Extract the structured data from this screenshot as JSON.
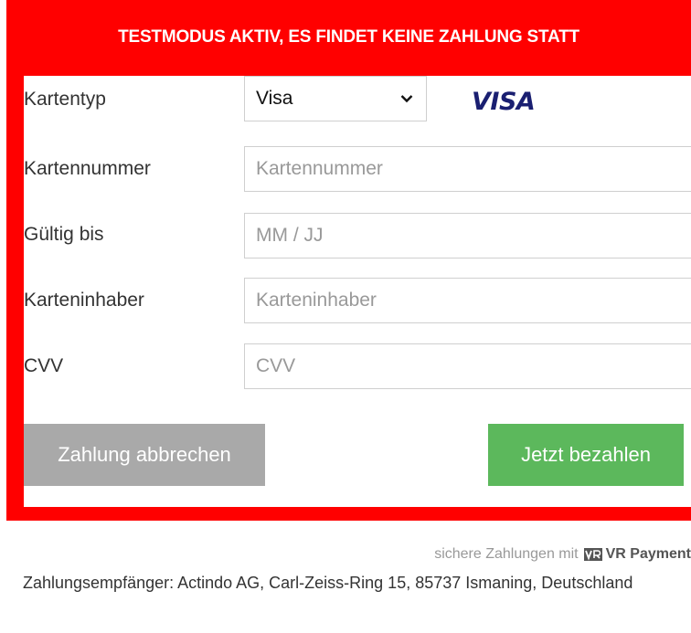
{
  "banner": {
    "text": "TESTMODUS AKTIV, ES FINDET KEINE ZAHLUNG STATT"
  },
  "form": {
    "card_type": {
      "label": "Kartentyp",
      "selected": "Visa",
      "logo_text": "VISA"
    },
    "card_number": {
      "label": "Kartennummer",
      "placeholder": "Kartennummer"
    },
    "expiry": {
      "label": "Gültig bis",
      "placeholder": "MM / JJ"
    },
    "holder": {
      "label": "Karteninhaber",
      "placeholder": "Karteninhaber"
    },
    "cvv": {
      "label": "CVV",
      "placeholder": "CVV"
    }
  },
  "buttons": {
    "cancel_label": "Zahlung abbrechen",
    "pay_label": "Jetzt bezahlen"
  },
  "footer": {
    "secure_text": "sichere Zahlungen mit",
    "brand_text": "VR Payment",
    "recipient": "Zahlungsempfänger: Actindo AG, Carl-Zeiss-Ring 15, 85737 Ismaning, Deutschland"
  },
  "colors": {
    "frame_red": "#ff0000",
    "pay_green": "#5cb85c",
    "cancel_gray": "#a9a9a9",
    "visa_blue": "#1a1f71"
  },
  "icons": {
    "select_chevron": "chevron-down-icon",
    "vr_logo": "vr-payment-logo-icon"
  }
}
